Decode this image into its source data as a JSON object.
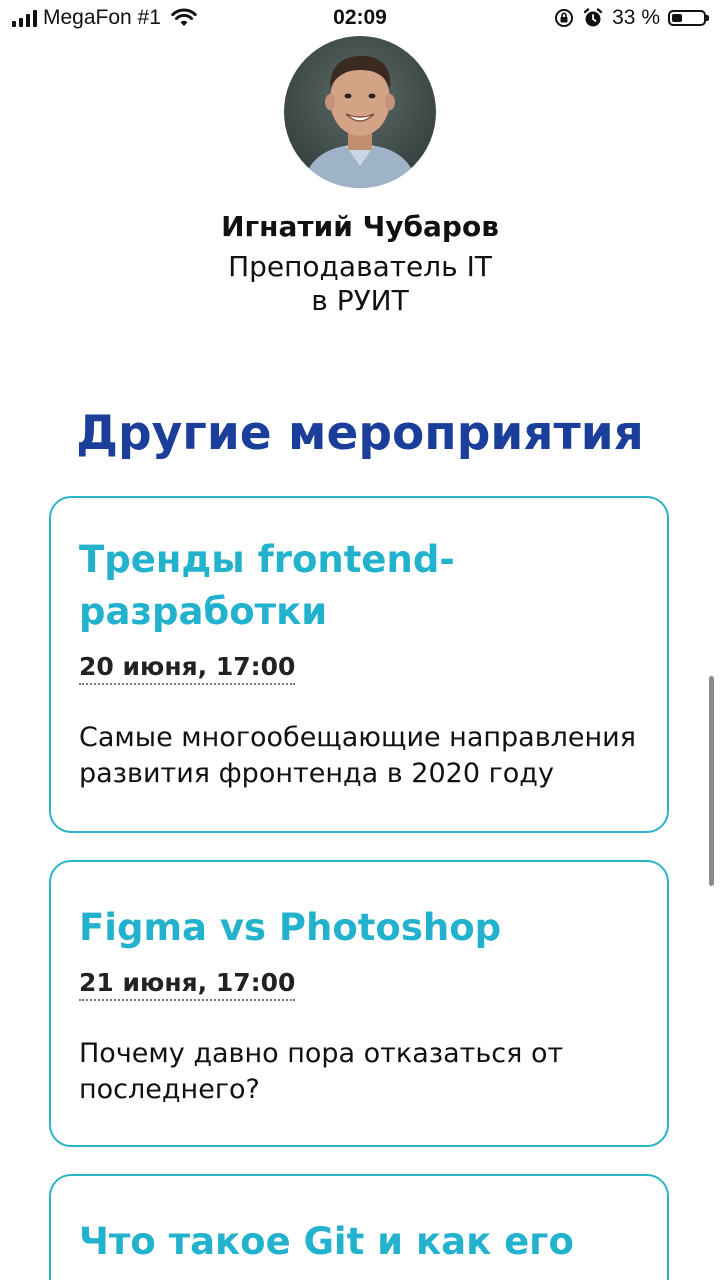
{
  "status_bar": {
    "carrier": "MegaFon #1",
    "time": "02:09",
    "battery_percent": "33 %",
    "battery_level": 0.33,
    "icons": [
      "signal-icon",
      "wifi-icon",
      "orientation-lock-icon",
      "alarm-icon",
      "battery-icon"
    ]
  },
  "speaker": {
    "name": "Игнатий Чубаров",
    "role_line1": "Преподаватель IT",
    "role_line2": "в РУИТ"
  },
  "section": {
    "title": "Другие мероприятия"
  },
  "events": [
    {
      "title_line1": "Тренды frontend-",
      "title_line2": "разработки",
      "date": "20 июня, 17:00",
      "description_line1": "Самые многообещающие направления",
      "description_line2": "развития фронтенда в 2020 году"
    },
    {
      "title_line1": "Figma vs Photoshop",
      "date": "21 июня, 17:00",
      "description_line1": "Почему давно пора отказаться от",
      "description_line2": "последнего?"
    },
    {
      "title_line1": "Что такое Git и как его"
    }
  ],
  "colors": {
    "accent_title": "#1a3e9a",
    "card_title": "#22b2cd",
    "card_border": "#2bb3c8"
  }
}
